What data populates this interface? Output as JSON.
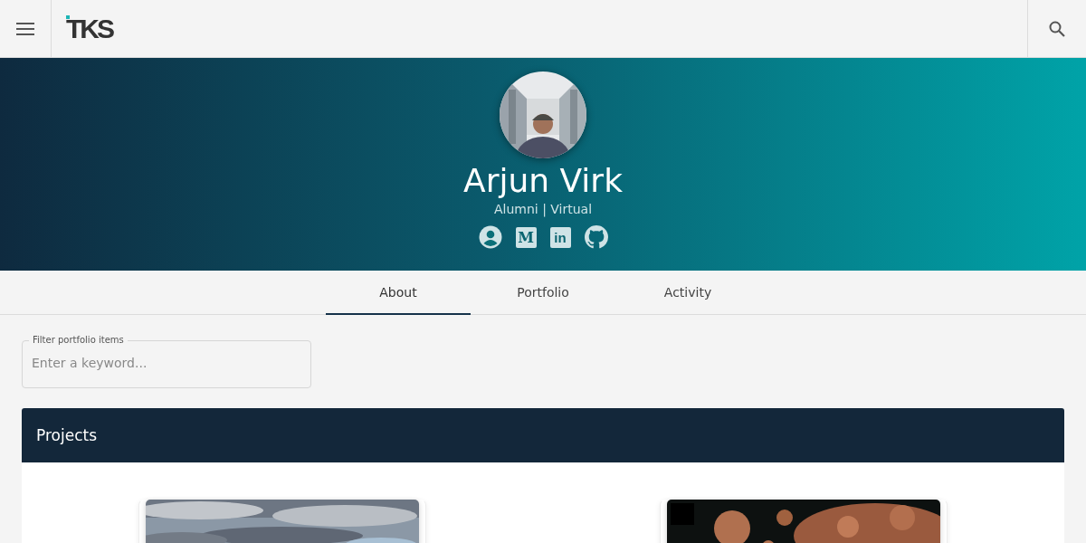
{
  "header": {
    "logo": "TKS"
  },
  "profile": {
    "name": "Arjun Virk",
    "subtitle": "Alumni | Virtual",
    "links": [
      {
        "kind": "account"
      },
      {
        "kind": "medium",
        "glyph": "M"
      },
      {
        "kind": "linkedin",
        "glyph": "in"
      },
      {
        "kind": "github"
      }
    ]
  },
  "tabs": [
    {
      "label": "About",
      "selected": true
    },
    {
      "label": "Portfolio",
      "selected": false
    },
    {
      "label": "Activity",
      "selected": false
    }
  ],
  "filter": {
    "label": "Filter portfolio items",
    "placeholder": "Enter a keyword..."
  },
  "section": {
    "title": "Projects",
    "cards": [
      {
        "kind": "sky"
      },
      {
        "kind": "virus"
      }
    ]
  }
}
